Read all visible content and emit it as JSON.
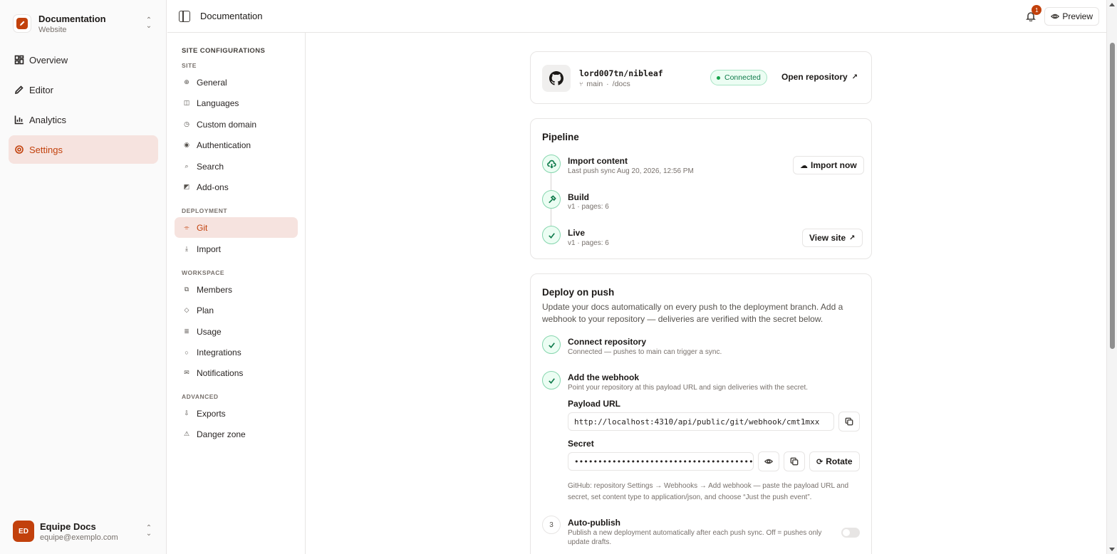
{
  "app": {
    "workspace_name": "Documentation",
    "workspace_sub": "Website",
    "nav": [
      {
        "label": "Overview",
        "icon": "grid-icon"
      },
      {
        "label": "Editor",
        "icon": "pen-icon"
      },
      {
        "label": "Analytics",
        "icon": "bar-chart-icon"
      },
      {
        "label": "Settings",
        "icon": "gear-icon",
        "active": true
      }
    ],
    "user": {
      "initials": "ED",
      "name": "Equipe Docs",
      "email": "equipe@exemplo.com"
    }
  },
  "topbar": {
    "title": "Documentation",
    "notification_count": "1",
    "preview_label": "Preview"
  },
  "subnav": {
    "heading": "SITE CONFIGURATIONS",
    "groups": [
      {
        "label": "SITE",
        "items": [
          {
            "label": "General",
            "icon": "globe-icon"
          },
          {
            "label": "Languages",
            "icon": "book-icon"
          },
          {
            "label": "Custom domain",
            "icon": "clock-icon"
          },
          {
            "label": "Authentication",
            "icon": "fingerprint-icon"
          },
          {
            "label": "Search",
            "icon": "search-icon"
          },
          {
            "label": "Add-ons",
            "icon": "puzzle-icon"
          }
        ]
      },
      {
        "label": "DEPLOYMENT",
        "items": [
          {
            "label": "Git",
            "icon": "git-icon",
            "active": true
          },
          {
            "label": "Import",
            "icon": "download-icon"
          }
        ]
      },
      {
        "label": "WORKSPACE",
        "items": [
          {
            "label": "Members",
            "icon": "users-icon"
          },
          {
            "label": "Plan",
            "icon": "diamond-icon"
          },
          {
            "label": "Usage",
            "icon": "list-icon"
          },
          {
            "label": "Integrations",
            "icon": "plug-icon"
          },
          {
            "label": "Notifications",
            "icon": "mail-icon"
          }
        ]
      },
      {
        "label": "ADVANCED",
        "items": [
          {
            "label": "Exports",
            "icon": "export-icon"
          },
          {
            "label": "Danger zone",
            "icon": "warning-icon"
          }
        ]
      }
    ]
  },
  "repo": {
    "name": "lord007tn/nibleaf",
    "branch": "main",
    "path": "/docs",
    "status": "Connected",
    "open_label": "Open repository"
  },
  "pipeline": {
    "title": "Pipeline",
    "steps": [
      {
        "title": "Import content",
        "sub": "Last push sync Aug 20, 2026, 12:56 PM",
        "action": "Import now",
        "icon": "cloud-download-icon"
      },
      {
        "title": "Build",
        "sub": "v1 · pages: 6",
        "icon": "hammer-icon"
      },
      {
        "title": "Live",
        "sub": "v1 · pages: 6",
        "action": "View site",
        "icon": "check-icon"
      }
    ]
  },
  "deploy": {
    "title": "Deploy on push",
    "description": "Update your docs automatically on every push to the deployment branch. Add a webhook to your repository — deliveries are verified with the secret below.",
    "steps": [
      {
        "title": "Connect repository",
        "sub": "Connected — pushes to main can trigger a sync."
      },
      {
        "title": "Add the webhook",
        "sub": "Point your repository at this payload URL and sign deliveries with the secret."
      },
      {
        "number": "3",
        "title": "Auto-publish",
        "sub": "Publish a new deployment automatically after each push sync. Off = pushes only update drafts."
      }
    ],
    "payload_label": "Payload URL",
    "payload_url": "http://localhost:4310/api/public/git/webhook/cmt1mxx",
    "secret_label": "Secret",
    "secret_masked": "••••••••••••••••••••••••••••••••••••••••••",
    "rotate_label": "Rotate",
    "help": "GitHub: repository Settings → Webhooks → Add webhook — paste the payload URL and secret, set content type to application/json, and choose “Just the push event”.",
    "auto_publish_enabled": false
  },
  "colors": {
    "accent": "#c2410c",
    "success": "#0f7a4b",
    "active_bg": "#f6e3df"
  }
}
